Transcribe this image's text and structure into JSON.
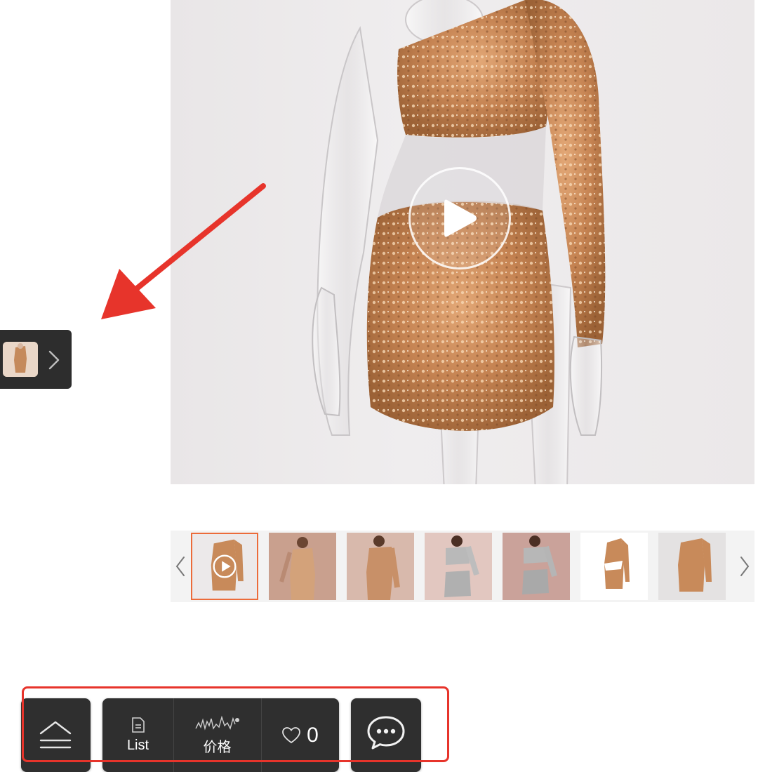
{
  "product_gallery": {
    "main_media": {
      "type": "video",
      "play_icon": "play-icon"
    },
    "thumbnails": [
      {
        "active": true,
        "has_video": true,
        "tone": "gold"
      },
      {
        "active": false,
        "has_video": false,
        "tone": "gold"
      },
      {
        "active": false,
        "has_video": false,
        "tone": "gold"
      },
      {
        "active": false,
        "has_video": false,
        "tone": "silver"
      },
      {
        "active": false,
        "has_video": false,
        "tone": "silver"
      },
      {
        "active": false,
        "has_video": false,
        "tone": "gold"
      },
      {
        "active": false,
        "has_video": false,
        "tone": "gold"
      }
    ],
    "prev_icon": "chevron-left-icon",
    "next_icon": "chevron-right-icon"
  },
  "mini_product_tab": {
    "icon": "chevron-right-icon"
  },
  "toolbar": {
    "top_icon": "back-to-top-icon",
    "list_label": "List",
    "list_icon": "document-icon",
    "price_label": "价格",
    "price_icon": "price-trend-icon",
    "favorite_count": "0",
    "favorite_icon": "heart-icon",
    "chat_icon": "chat-bubble-icon"
  },
  "colors": {
    "accent_orange": "#ec6b3a",
    "annotation_red": "#e7342b",
    "toolbar_bg": "#2f2f2f"
  }
}
